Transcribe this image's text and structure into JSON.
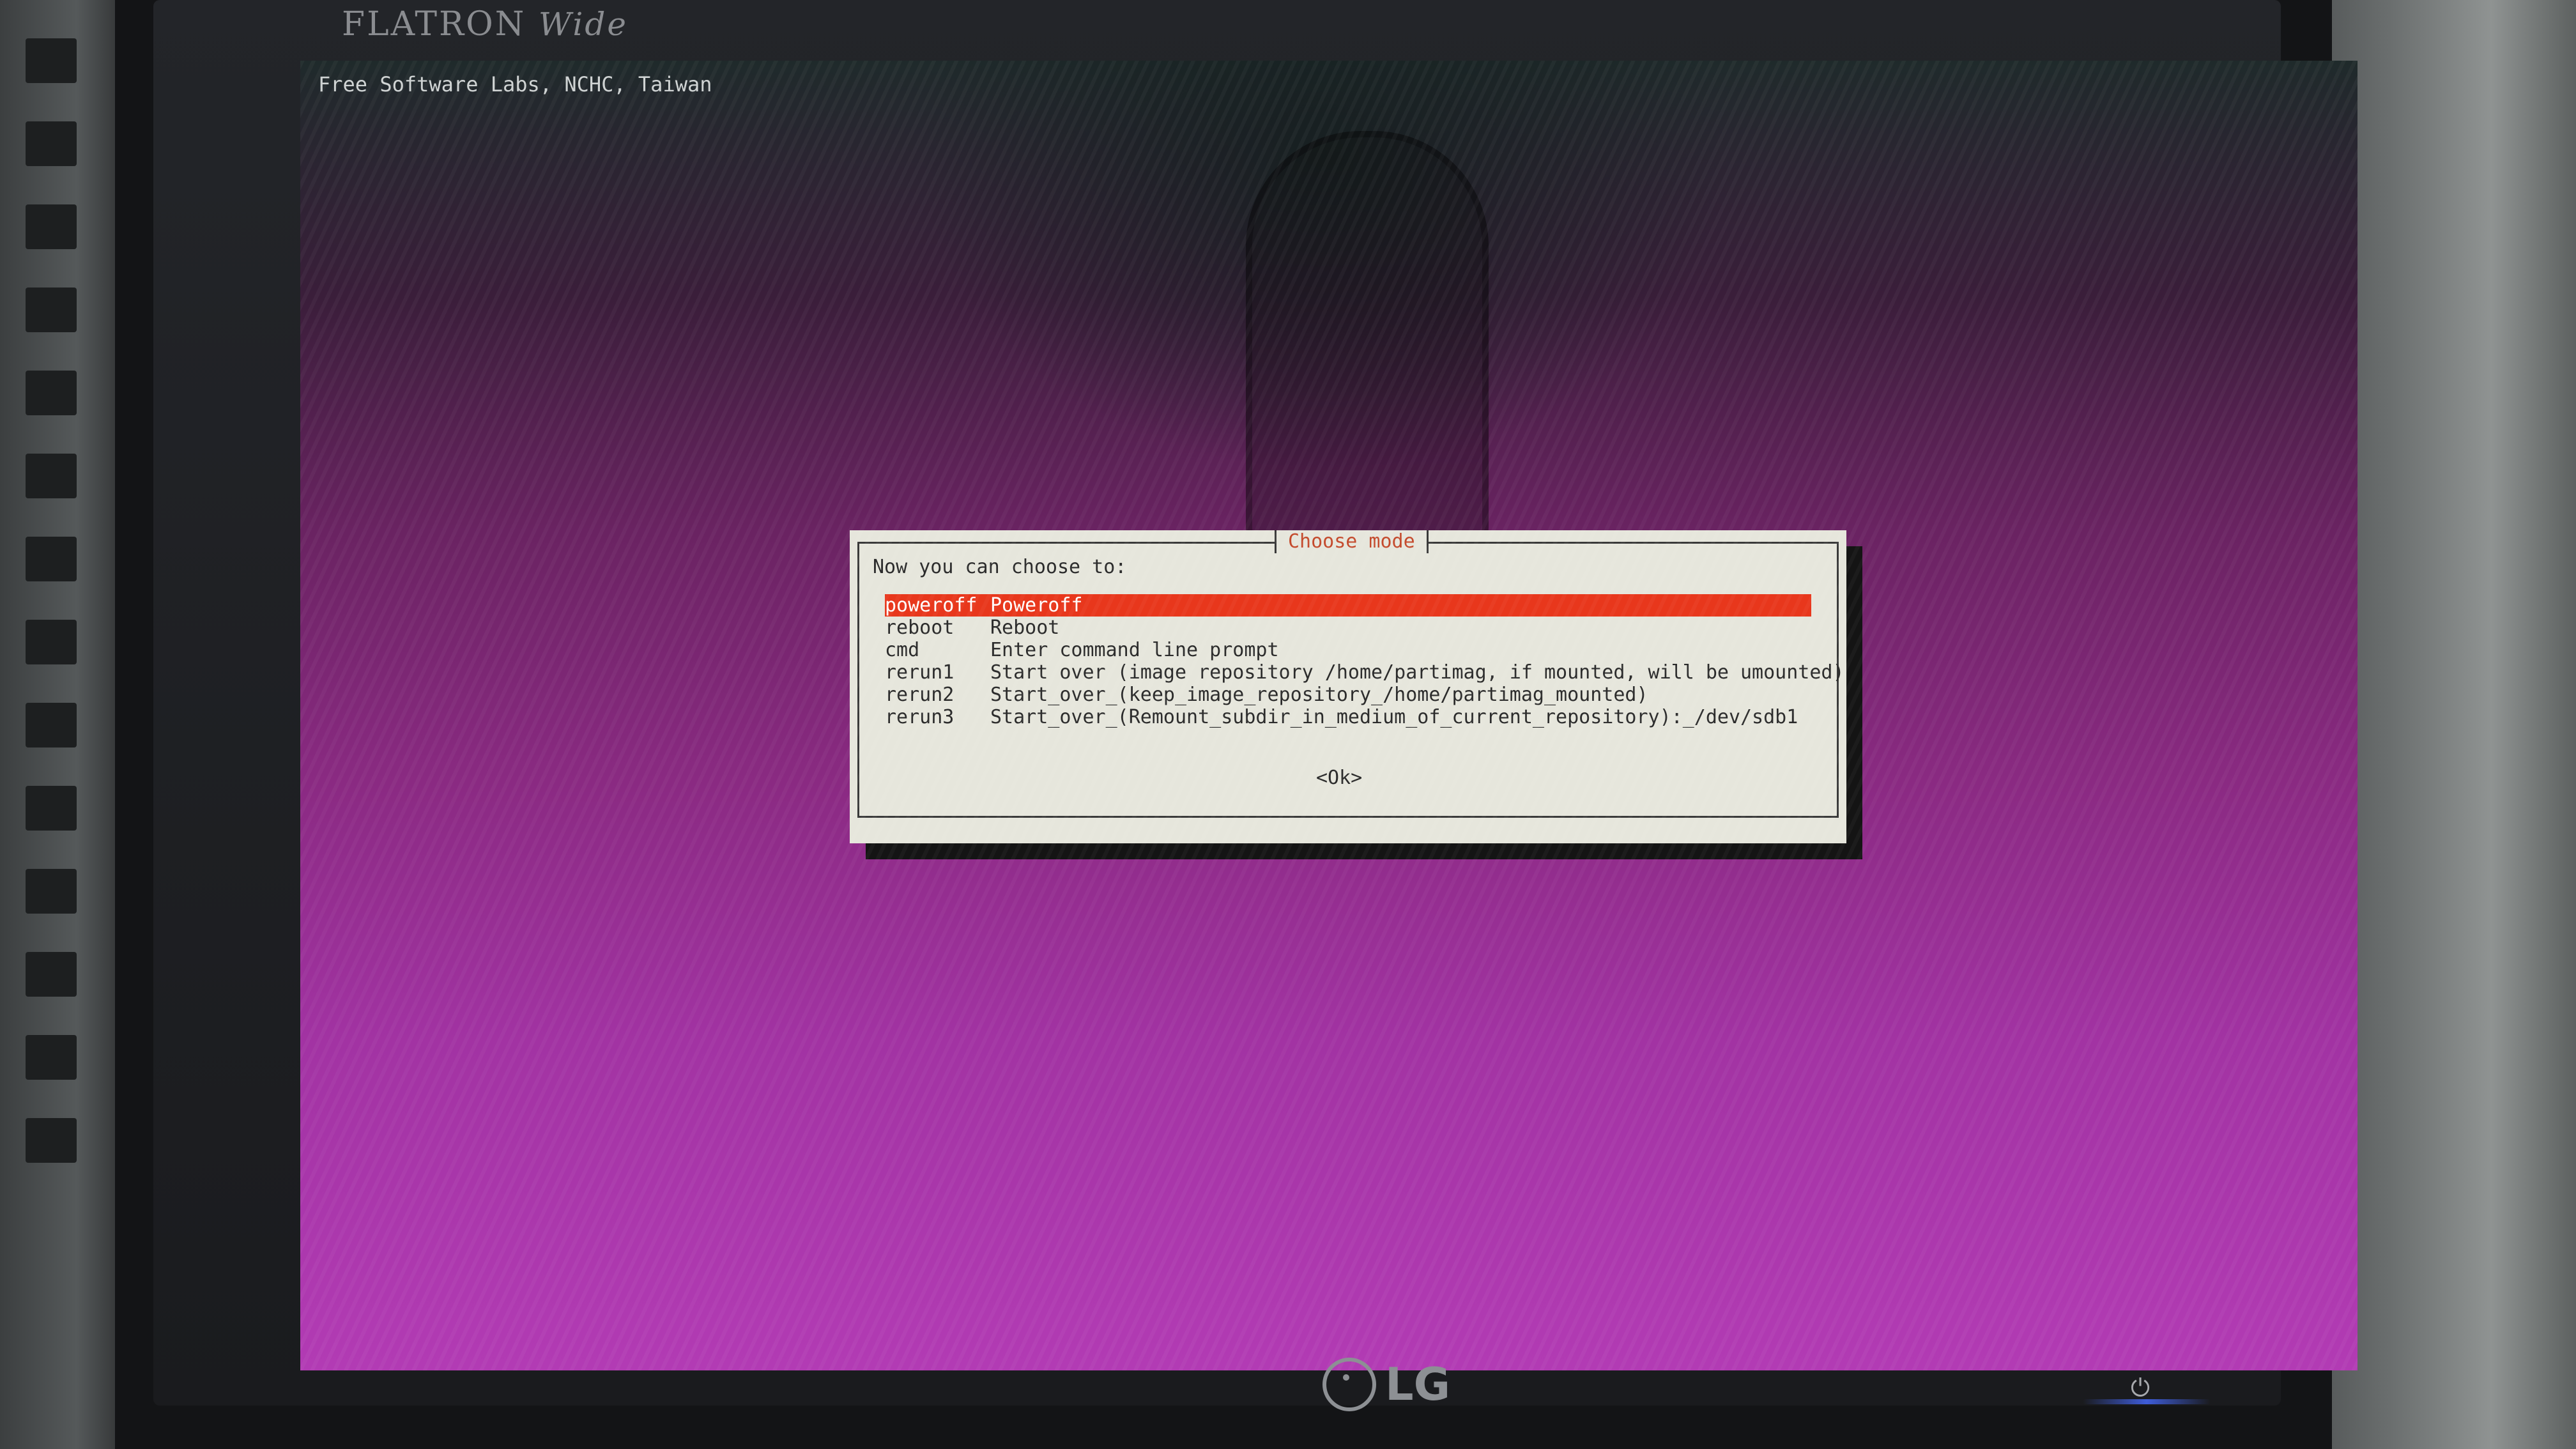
{
  "monitor": {
    "brand_top": "FLATRON",
    "brand_top_suffix": "Wide",
    "brand_bottom": "LG",
    "power_symbol": "⏻"
  },
  "screen": {
    "banner": "Free Software Labs, NCHC, Taiwan"
  },
  "dialog": {
    "title": "Choose mode",
    "prompt": "Now you can choose to:",
    "ok_label": "<Ok>",
    "items": [
      {
        "key": "poweroff",
        "description": "Poweroff",
        "selected": true
      },
      {
        "key": "reboot",
        "description": "Reboot",
        "selected": false
      },
      {
        "key": "cmd",
        "description": "Enter command line prompt",
        "selected": false
      },
      {
        "key": "rerun1",
        "description": "Start over (image repository /home/partimag, if mounted, will be umounted)",
        "selected": false
      },
      {
        "key": "rerun2",
        "description": "Start_over_(keep_image_repository_/home/partimag_mounted)",
        "selected": false
      },
      {
        "key": "rerun3",
        "description": "Start_over_(Remount_subdir_in_medium_of_current_repository):_/dev/sdb1",
        "selected": false
      }
    ]
  },
  "colors": {
    "selection": "#e8371c",
    "title_text": "#c44a2c",
    "dialog_bg": "#e6e6dc"
  }
}
